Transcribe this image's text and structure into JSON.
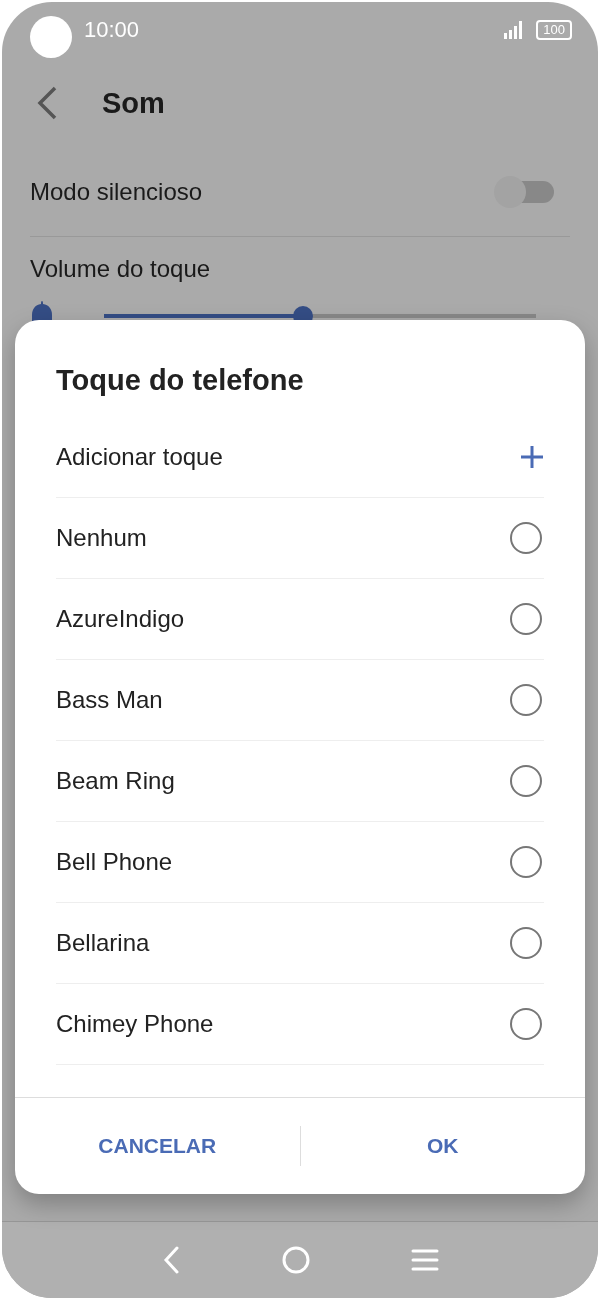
{
  "status_bar": {
    "time": "10:00",
    "battery": "100"
  },
  "header": {
    "title": "Som"
  },
  "settings": [
    {
      "kind": "toggle",
      "label": "Modo silencioso",
      "on": false
    },
    {
      "kind": "slider",
      "label": "Volume do toque",
      "level": 0.46
    }
  ],
  "dialog": {
    "title": "Toque do telefone",
    "add_label": "Adicionar toque",
    "ringtones": [
      {
        "label": "Nenhum",
        "selected": false
      },
      {
        "label": "AzureIndigo",
        "selected": false
      },
      {
        "label": "Bass Man",
        "selected": false
      },
      {
        "label": "Beam Ring",
        "selected": false
      },
      {
        "label": "Bell Phone",
        "selected": false
      },
      {
        "label": "Bellarina",
        "selected": false
      },
      {
        "label": "Chimey Phone",
        "selected": false
      }
    ],
    "buttons": [
      "CANCELAR",
      "OK"
    ]
  }
}
